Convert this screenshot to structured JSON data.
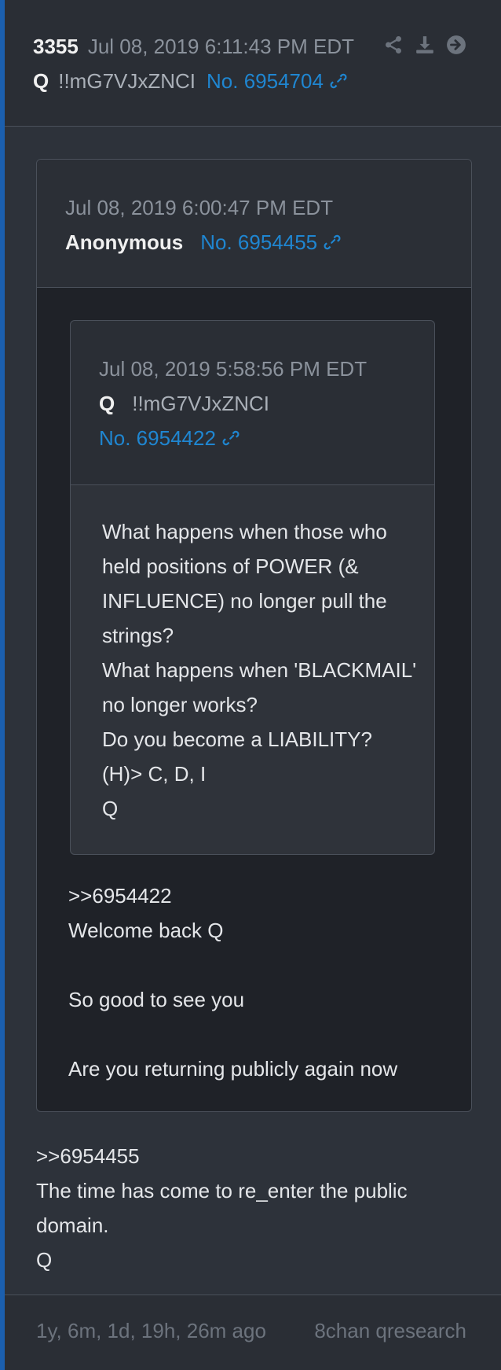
{
  "post": {
    "number": "3355",
    "datetime": "Jul 08, 2019 6:11:43 PM EDT",
    "author": "Q",
    "tripcode": "!!mG7VJxZNCI",
    "post_id": "No. 6954704",
    "actions": [
      "share-icon",
      "download-icon",
      "arrow-right-circle-icon"
    ],
    "body": [
      ">>6954455",
      "The time has come to re_enter the public domain.",
      "Q"
    ]
  },
  "quoted": {
    "datetime": "Jul 08, 2019 6:00:47 PM EDT",
    "author": "Anonymous",
    "post_id": "No. 6954455",
    "body": [
      ">>6954422",
      "Welcome back Q",
      "",
      "So good to see you",
      "",
      "Are you returning publicly again now"
    ],
    "quoted": {
      "datetime": "Jul 08, 2019 5:58:56 PM EDT",
      "author": "Q",
      "tripcode": "!!mG7VJxZNCI",
      "post_id": "No. 6954422",
      "body": [
        "What happens when those who held positions of POWER (& INFLUENCE) no longer pull the strings?",
        "What happens when 'BLACKMAIL' no longer works?",
        "Do you become a LIABILITY?",
        "(H)> C, D, I",
        "Q"
      ]
    }
  },
  "footer": {
    "age": "1y, 6m, 1d, 19h, 26m ago",
    "source": "8chan qresearch"
  },
  "colors": {
    "accent_link": "#1f86d1",
    "left_border": "#1b5fae",
    "background": "#2d323a"
  }
}
